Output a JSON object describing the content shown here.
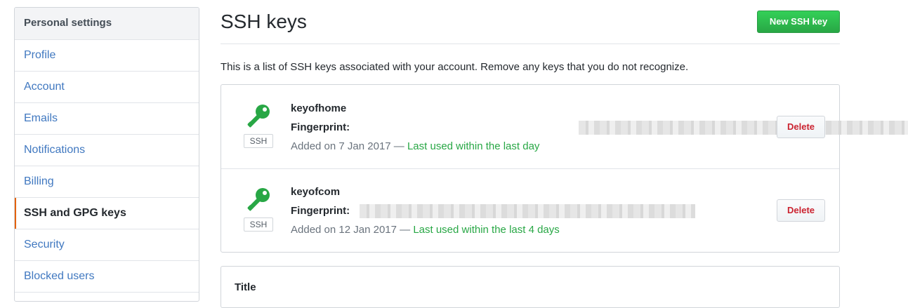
{
  "sidebar": {
    "header": "Personal settings",
    "items": [
      {
        "label": "Profile"
      },
      {
        "label": "Account"
      },
      {
        "label": "Emails"
      },
      {
        "label": "Notifications"
      },
      {
        "label": "Billing"
      },
      {
        "label": "SSH and GPG keys",
        "selected": true
      },
      {
        "label": "Security"
      },
      {
        "label": "Blocked users"
      }
    ]
  },
  "main": {
    "title": "SSH keys",
    "new_key_button": "New SSH key",
    "intro": "This is a list of SSH keys associated with your account. Remove any keys that you do not recognize.",
    "keys": [
      {
        "icon": "key-icon",
        "type_label": "SSH",
        "title": "keyofhome",
        "fingerprint_label": "Fingerprint:",
        "added": "Added on 7 Jan 2017 — ",
        "last_used": "Last used within the last day",
        "delete_label": "Delete"
      },
      {
        "icon": "key-icon",
        "type_label": "SSH",
        "title": "keyofcom",
        "fingerprint_label": "Fingerprint:",
        "added": "Added on 12 Jan 2017 — ",
        "last_used": "Last used within the last 4 days",
        "delete_label": "Delete"
      }
    ],
    "add_form": {
      "title_label": "Title"
    }
  },
  "colors": {
    "accent_green": "#28a745",
    "link_blue": "#4078c0",
    "delete_red": "#cb2431",
    "selected_marker": "#e36209"
  }
}
